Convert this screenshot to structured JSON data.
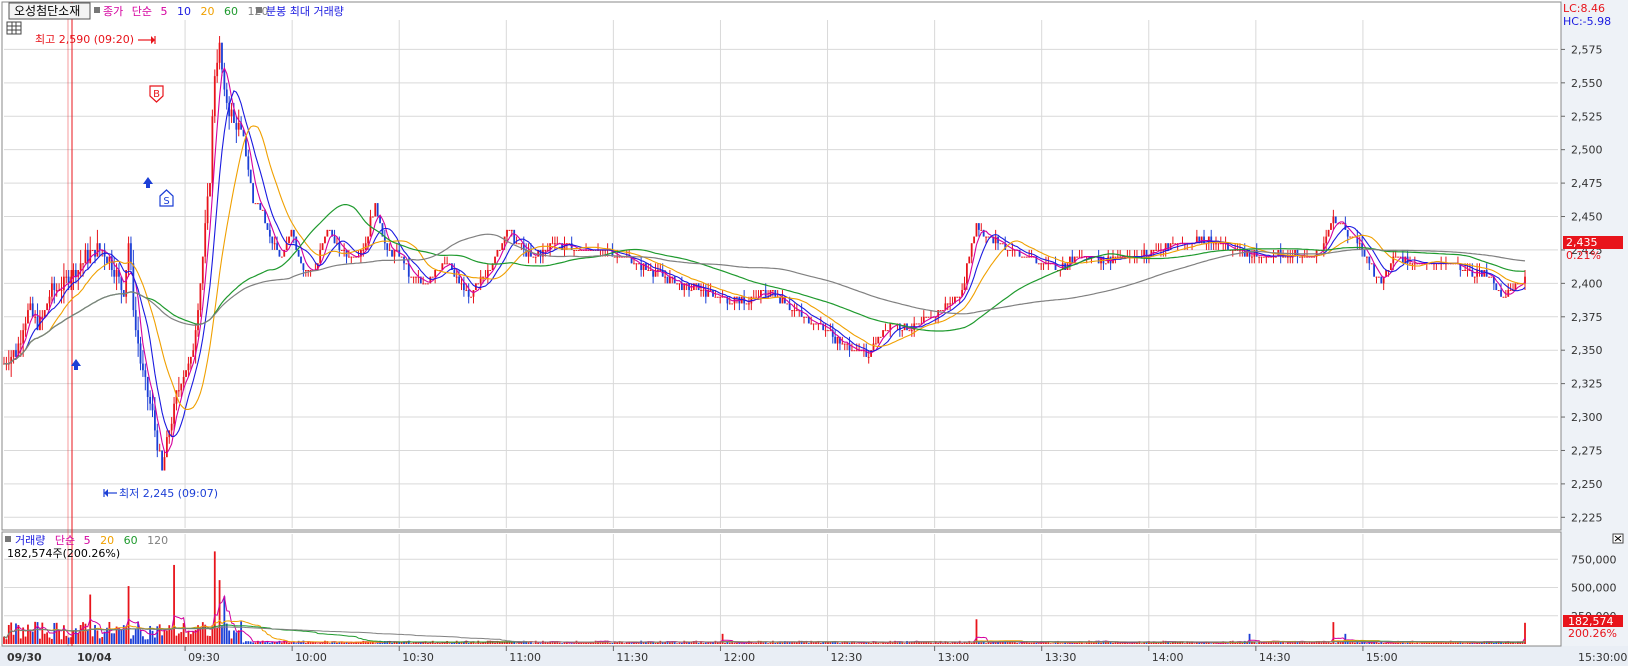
{
  "header": {
    "stock_name": "오성첨단소재",
    "chart_kind": "종가",
    "ma_type": "단순",
    "ma_periods": [
      "5",
      "10",
      "20",
      "60",
      "120"
    ],
    "ma_colors": [
      "#d4009f",
      "#1a1ae0",
      "#f0a000",
      "#1f9a2e",
      "#808080"
    ],
    "extra_label": "분봉 최대 거래량",
    "lc_text": "LC:8.46",
    "hc_text": "HC:-5.98"
  },
  "annotations": {
    "high_text": "최고 2,590 (09:20)",
    "low_text": "최저 2,245 (09:07)",
    "buy_marker": "B",
    "sell_marker": "S",
    "current_price": "2,435",
    "current_change": "0.21%"
  },
  "volume_header": {
    "title": "거래량",
    "ma_type": "단순",
    "ma_periods": [
      "5",
      "20",
      "60",
      "120"
    ],
    "ma_colors": [
      "#d4009f",
      "#f0a000",
      "#1f9a2e",
      "#808080"
    ],
    "current_text": "182,574주(200.26%)",
    "current_volume": "182,574",
    "current_pct": "200.26%"
  },
  "colors": {
    "up": "#e8141b",
    "down": "#1c3fd6",
    "grid": "#d9d9d9",
    "axis_bg": "#e9eef5"
  },
  "chart_data": [
    {
      "type": "candlestick",
      "title": "오성첨단소재 종가 단순 5 10 20 60 120 분봉 최대 거래량",
      "yticks": [
        2225,
        2250,
        2275,
        2300,
        2325,
        2350,
        2375,
        2400,
        2425,
        2450,
        2475,
        2500,
        2525,
        2550,
        2575
      ],
      "ytick_labels": [
        "2,225",
        "2,250",
        "2,275",
        "2,300",
        "2,325",
        "2,350",
        "2,375",
        "2,400",
        "2,425",
        "2,450",
        "2,475",
        "2,500",
        "2,525",
        "2,550",
        "2,575"
      ],
      "ylim": [
        2217,
        2597
      ],
      "xtick_labels": [
        "09/30",
        "10/04",
        "09:30",
        "10:00",
        "10:30",
        "11:00",
        "11:30",
        "12:00",
        "12:30",
        "13:00",
        "13:30",
        "14:00",
        "14:30",
        "15:00",
        "15:30:00"
      ],
      "price_path": [
        [
          0,
          2340
        ],
        [
          5,
          2350
        ],
        [
          10,
          2380
        ],
        [
          15,
          2370
        ],
        [
          20,
          2395
        ],
        [
          25,
          2400
        ],
        [
          30,
          2410
        ],
        [
          35,
          2420
        ],
        [
          40,
          2425
        ],
        [
          45,
          2415
        ],
        [
          50,
          2395
        ],
        [
          52,
          2430
        ],
        [
          55,
          2365
        ],
        [
          58,
          2330
        ],
        [
          62,
          2300
        ],
        [
          66,
          2260
        ],
        [
          70,
          2300
        ],
        [
          74,
          2330
        ],
        [
          78,
          2340
        ],
        [
          82,
          2400
        ],
        [
          86,
          2480
        ],
        [
          88,
          2560
        ],
        [
          90,
          2575
        ],
        [
          92,
          2540
        ],
        [
          96,
          2520
        ],
        [
          100,
          2510
        ],
        [
          104,
          2460
        ],
        [
          108,
          2455
        ],
        [
          112,
          2430
        ],
        [
          116,
          2420
        ],
        [
          120,
          2440
        ],
        [
          125,
          2410
        ],
        [
          130,
          2410
        ],
        [
          135,
          2440
        ],
        [
          140,
          2425
        ],
        [
          145,
          2420
        ],
        [
          150,
          2425
        ],
        [
          155,
          2460
        ],
        [
          160,
          2425
        ],
        [
          165,
          2420
        ],
        [
          170,
          2405
        ],
        [
          175,
          2400
        ],
        [
          180,
          2410
        ],
        [
          185,
          2415
        ],
        [
          190,
          2400
        ],
        [
          195,
          2390
        ],
        [
          200,
          2405
        ],
        [
          205,
          2420
        ],
        [
          210,
          2440
        ],
        [
          215,
          2430
        ],
        [
          220,
          2420
        ],
        [
          225,
          2425
        ],
        [
          230,
          2430
        ],
        [
          240,
          2425
        ],
        [
          250,
          2425
        ],
        [
          260,
          2420
        ],
        [
          270,
          2410
        ],
        [
          280,
          2400
        ],
        [
          290,
          2395
        ],
        [
          300,
          2390
        ],
        [
          310,
          2385
        ],
        [
          320,
          2395
        ],
        [
          330,
          2380
        ],
        [
          340,
          2370
        ],
        [
          350,
          2355
        ],
        [
          360,
          2345
        ],
        [
          365,
          2360
        ],
        [
          370,
          2370
        ],
        [
          380,
          2368
        ],
        [
          390,
          2378
        ],
        [
          400,
          2395
        ],
        [
          403,
          2420
        ],
        [
          406,
          2445
        ],
        [
          410,
          2435
        ],
        [
          420,
          2425
        ],
        [
          430,
          2418
        ],
        [
          440,
          2412
        ],
        [
          450,
          2420
        ],
        [
          460,
          2418
        ],
        [
          470,
          2420
        ],
        [
          480,
          2425
        ],
        [
          490,
          2430
        ],
        [
          500,
          2432
        ],
        [
          510,
          2428
        ],
        [
          520,
          2422
        ],
        [
          530,
          2420
        ],
        [
          540,
          2422
        ],
        [
          545,
          2420
        ],
        [
          550,
          2425
        ],
        [
          555,
          2450
        ],
        [
          560,
          2440
        ],
        [
          565,
          2430
        ],
        [
          570,
          2415
        ],
        [
          575,
          2400
        ],
        [
          580,
          2420
        ],
        [
          590,
          2415
        ],
        [
          600,
          2415
        ],
        [
          610,
          2410
        ],
        [
          620,
          2405
        ],
        [
          625,
          2390
        ],
        [
          630,
          2395
        ],
        [
          635,
          2405
        ]
      ],
      "max_minute": 635,
      "ma_series": [
        {
          "name": "5",
          "color": "#d4009f"
        },
        {
          "name": "10",
          "color": "#1a1ae0"
        },
        {
          "name": "20",
          "color": "#f0a000"
        },
        {
          "name": "60",
          "color": "#1f9a2e"
        },
        {
          "name": "120",
          "color": "#808080"
        }
      ]
    },
    {
      "type": "bar",
      "title": "거래량 단순 5 20 60 120",
      "yticks": [
        250000,
        500000,
        750000
      ],
      "ytick_labels": [
        "250,000",
        "500,000",
        "750,000"
      ],
      "ylim": [
        0,
        850000
      ]
    }
  ]
}
